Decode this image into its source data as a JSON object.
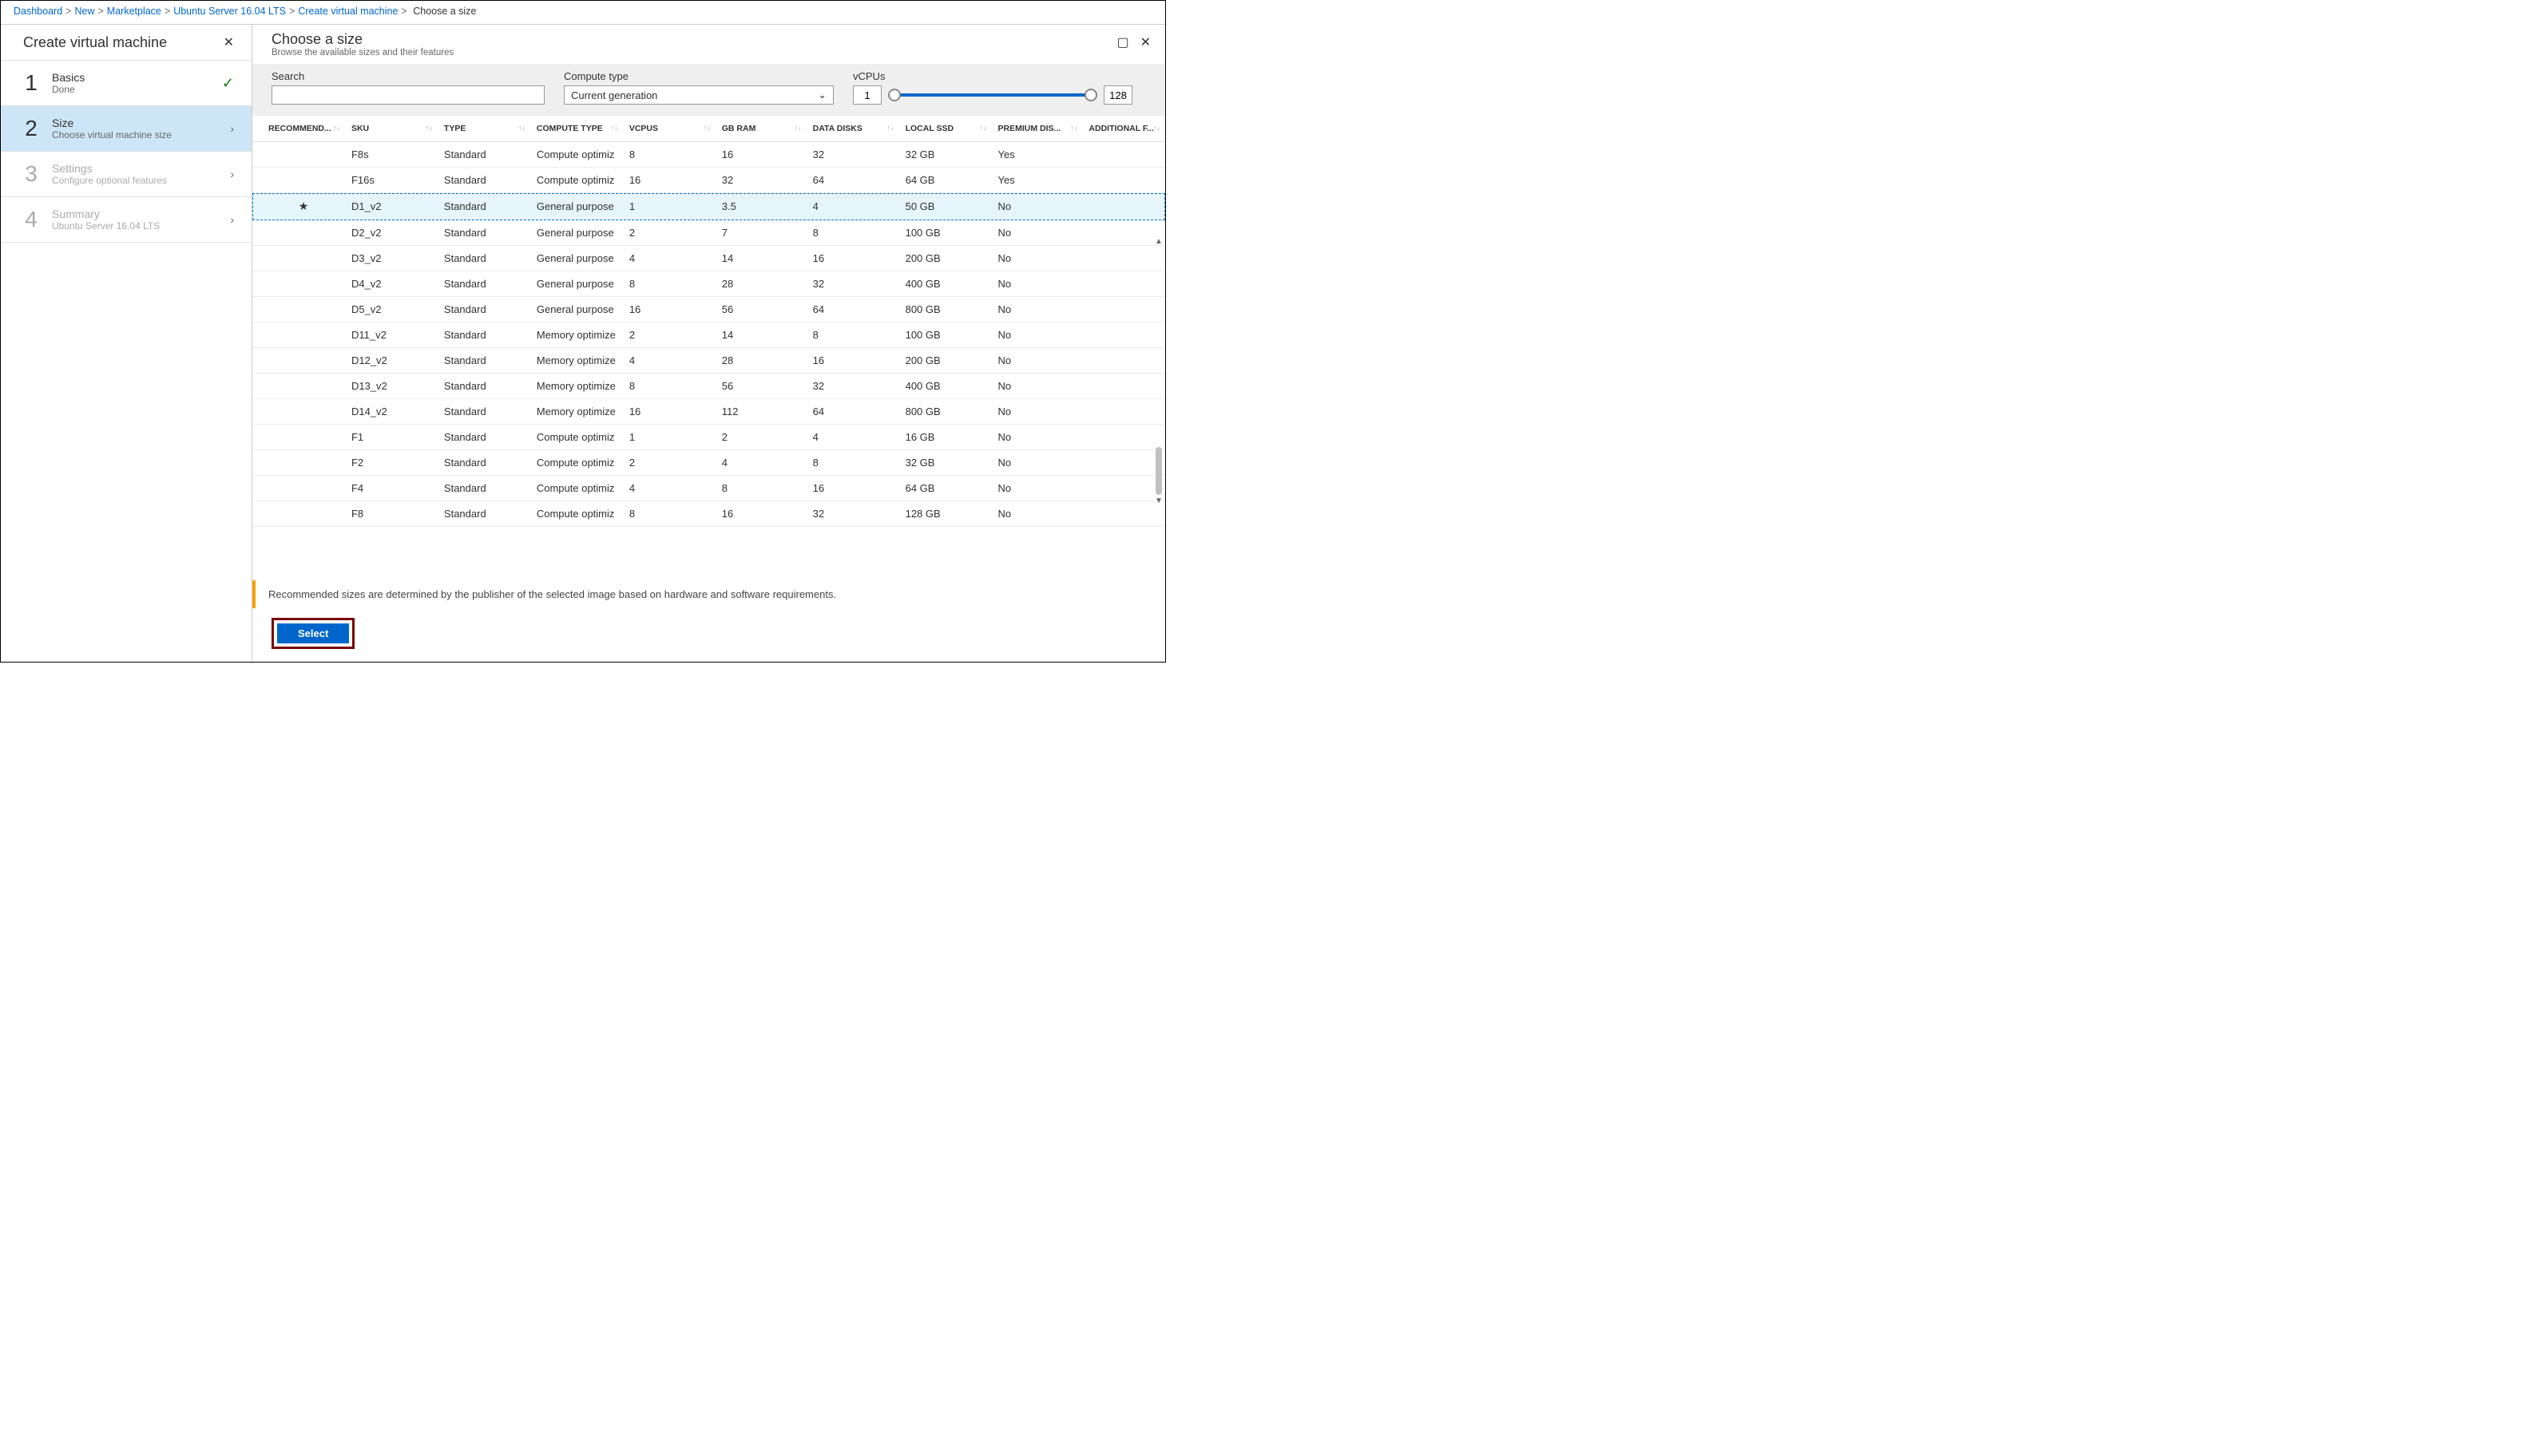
{
  "breadcrumb": {
    "items": [
      "Dashboard",
      "New",
      "Marketplace",
      "Ubuntu Server 16.04 LTS",
      "Create virtual machine"
    ],
    "current": "Choose a size"
  },
  "leftBlade": {
    "title": "Create virtual machine",
    "steps": [
      {
        "num": "1",
        "title": "Basics",
        "sub": "Done",
        "state": "done"
      },
      {
        "num": "2",
        "title": "Size",
        "sub": "Choose virtual machine size",
        "state": "active"
      },
      {
        "num": "3",
        "title": "Settings",
        "sub": "Configure optional features",
        "state": "disabled"
      },
      {
        "num": "4",
        "title": "Summary",
        "sub": "Ubuntu Server 16.04 LTS",
        "state": "disabled"
      }
    ]
  },
  "mainBlade": {
    "title": "Choose a size",
    "sub": "Browse the available sizes and their features",
    "filters": {
      "searchLabel": "Search",
      "computeLabel": "Compute type",
      "computeValue": "Current generation",
      "vcpusLabel": "vCPUs",
      "vcpusMin": "1",
      "vcpusMax": "128"
    },
    "columns": [
      "RECOMMEND...",
      "SKU",
      "TYPE",
      "COMPUTE TYPE",
      "VCPUS",
      "GB RAM",
      "DATA DISKS",
      "LOCAL SSD",
      "PREMIUM DIS...",
      "ADDITIONAL F..."
    ],
    "rows": [
      {
        "rec": "",
        "sku": "F8s",
        "type": "Standard",
        "ct": "Compute optimiz",
        "vcpus": "8",
        "ram": "16",
        "dd": "32",
        "ssd": "32 GB",
        "prem": "Yes",
        "add": "",
        "sel": false
      },
      {
        "rec": "",
        "sku": "F16s",
        "type": "Standard",
        "ct": "Compute optimiz",
        "vcpus": "16",
        "ram": "32",
        "dd": "64",
        "ssd": "64 GB",
        "prem": "Yes",
        "add": "",
        "sel": false
      },
      {
        "rec": "★",
        "sku": "D1_v2",
        "type": "Standard",
        "ct": "General purpose",
        "vcpus": "1",
        "ram": "3.5",
        "dd": "4",
        "ssd": "50 GB",
        "prem": "No",
        "add": "",
        "sel": true
      },
      {
        "rec": "",
        "sku": "D2_v2",
        "type": "Standard",
        "ct": "General purpose",
        "vcpus": "2",
        "ram": "7",
        "dd": "8",
        "ssd": "100 GB",
        "prem": "No",
        "add": "",
        "sel": false
      },
      {
        "rec": "",
        "sku": "D3_v2",
        "type": "Standard",
        "ct": "General purpose",
        "vcpus": "4",
        "ram": "14",
        "dd": "16",
        "ssd": "200 GB",
        "prem": "No",
        "add": "",
        "sel": false
      },
      {
        "rec": "",
        "sku": "D4_v2",
        "type": "Standard",
        "ct": "General purpose",
        "vcpus": "8",
        "ram": "28",
        "dd": "32",
        "ssd": "400 GB",
        "prem": "No",
        "add": "",
        "sel": false
      },
      {
        "rec": "",
        "sku": "D5_v2",
        "type": "Standard",
        "ct": "General purpose",
        "vcpus": "16",
        "ram": "56",
        "dd": "64",
        "ssd": "800 GB",
        "prem": "No",
        "add": "",
        "sel": false
      },
      {
        "rec": "",
        "sku": "D11_v2",
        "type": "Standard",
        "ct": "Memory optimize",
        "vcpus": "2",
        "ram": "14",
        "dd": "8",
        "ssd": "100 GB",
        "prem": "No",
        "add": "",
        "sel": false
      },
      {
        "rec": "",
        "sku": "D12_v2",
        "type": "Standard",
        "ct": "Memory optimize",
        "vcpus": "4",
        "ram": "28",
        "dd": "16",
        "ssd": "200 GB",
        "prem": "No",
        "add": "",
        "sel": false
      },
      {
        "rec": "",
        "sku": "D13_v2",
        "type": "Standard",
        "ct": "Memory optimize",
        "vcpus": "8",
        "ram": "56",
        "dd": "32",
        "ssd": "400 GB",
        "prem": "No",
        "add": "",
        "sel": false
      },
      {
        "rec": "",
        "sku": "D14_v2",
        "type": "Standard",
        "ct": "Memory optimize",
        "vcpus": "16",
        "ram": "112",
        "dd": "64",
        "ssd": "800 GB",
        "prem": "No",
        "add": "",
        "sel": false
      },
      {
        "rec": "",
        "sku": "F1",
        "type": "Standard",
        "ct": "Compute optimiz",
        "vcpus": "1",
        "ram": "2",
        "dd": "4",
        "ssd": "16 GB",
        "prem": "No",
        "add": "",
        "sel": false
      },
      {
        "rec": "",
        "sku": "F2",
        "type": "Standard",
        "ct": "Compute optimiz",
        "vcpus": "2",
        "ram": "4",
        "dd": "8",
        "ssd": "32 GB",
        "prem": "No",
        "add": "",
        "sel": false
      },
      {
        "rec": "",
        "sku": "F4",
        "type": "Standard",
        "ct": "Compute optimiz",
        "vcpus": "4",
        "ram": "8",
        "dd": "16",
        "ssd": "64 GB",
        "prem": "No",
        "add": "",
        "sel": false
      },
      {
        "rec": "",
        "sku": "F8",
        "type": "Standard",
        "ct": "Compute optimiz",
        "vcpus": "8",
        "ram": "16",
        "dd": "32",
        "ssd": "128 GB",
        "prem": "No",
        "add": "",
        "sel": false
      }
    ],
    "info": "Recommended sizes are determined by the publisher of the selected image based on hardware and software requirements.",
    "selectLabel": "Select"
  }
}
